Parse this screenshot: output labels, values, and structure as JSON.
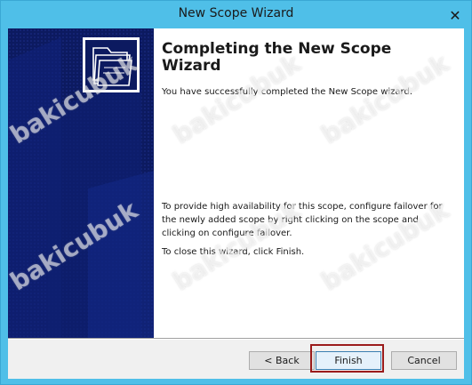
{
  "window": {
    "title": "New Scope Wizard",
    "close_glyph": "✕"
  },
  "content": {
    "heading": "Completing the New Scope Wizard",
    "intro": "You have successfully completed the New Scope wizard.",
    "failover": "To provide high availability for this scope, configure failover for the newly added scope by right clicking on the scope and clicking on configure failover.",
    "close_hint": "To close this wizard, click Finish."
  },
  "buttons": {
    "back": "< Back",
    "finish": "Finish",
    "cancel": "Cancel"
  },
  "side_panel": {
    "icon": "folder-wizard-icon"
  },
  "watermark": "bakicubuk",
  "colors": {
    "title_bar": "#4fbfe8",
    "side_panel": "#0c1a60",
    "highlight": "#9b1b1b"
  }
}
